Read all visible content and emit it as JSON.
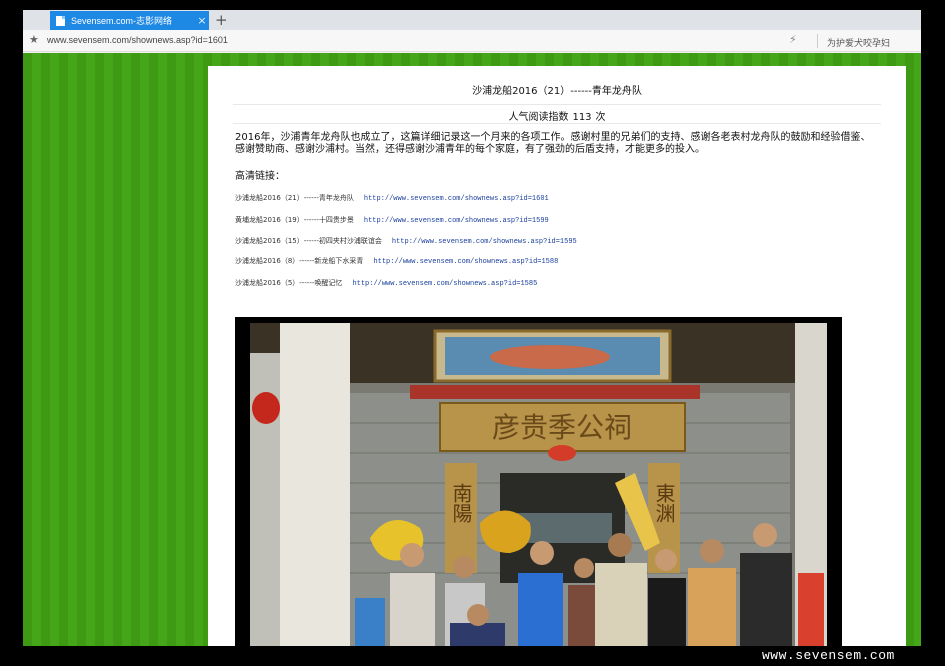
{
  "browser": {
    "tab_title": "Sevensem.com-志影网络",
    "tab_close": "×",
    "new_tab": "+",
    "url": "www.sevensem.com/shownews.asp?id=1601",
    "extension_text": "为护爱犬咬孕妇"
  },
  "article": {
    "title": "沙浦龙船2016（21）------青年龙舟队",
    "read_label": "人气阅读指数",
    "read_count": "113",
    "read_unit": "次",
    "body": "2016年，沙浦青年龙舟队也成立了，这篇详细记录这一个月来的各项工作。感谢村里的兄弟们的支持、感谢各老表村龙舟队的鼓励和经验借鉴、感谢赞助商、感谢沙浦村。当然，还得感谢沙浦青年的每个家庭，有了强劲的后盾支持，才能更多的投入。",
    "links_heading": "高清链接：",
    "links": [
      {
        "label": "沙浦龙船2016（21）------青年龙舟队",
        "url": "http://www.sevensem.com/shownews.asp?id=1601"
      },
      {
        "label": "黄埔龙船2016（19）------十四贵步景",
        "url": "http://www.sevensem.com/shownews.asp?id=1599"
      },
      {
        "label": "沙浦龙船2016（15）------初四夹村沙浦联谊会",
        "url": "http://www.sevensem.com/shownews.asp?id=1595"
      },
      {
        "label": "沙浦龙船2016（8）------新龙船下水采青",
        "url": "http://www.sevensem.com/shownews.asp?id=1588"
      },
      {
        "label": "沙浦龙船2016（5）------唤醒记忆",
        "url": "http://www.sevensem.com/shownews.asp?id=1585"
      }
    ],
    "photo": {
      "plaque": "彦贵季公祠",
      "couplet_left": "南陽",
      "couplet_right": "東渊"
    }
  },
  "watermark": "www.sevensem.com",
  "colors": {
    "tab_blue": "#1e88e5",
    "page_green": "#3d9a12",
    "link_blue": "#1a3f9c"
  }
}
